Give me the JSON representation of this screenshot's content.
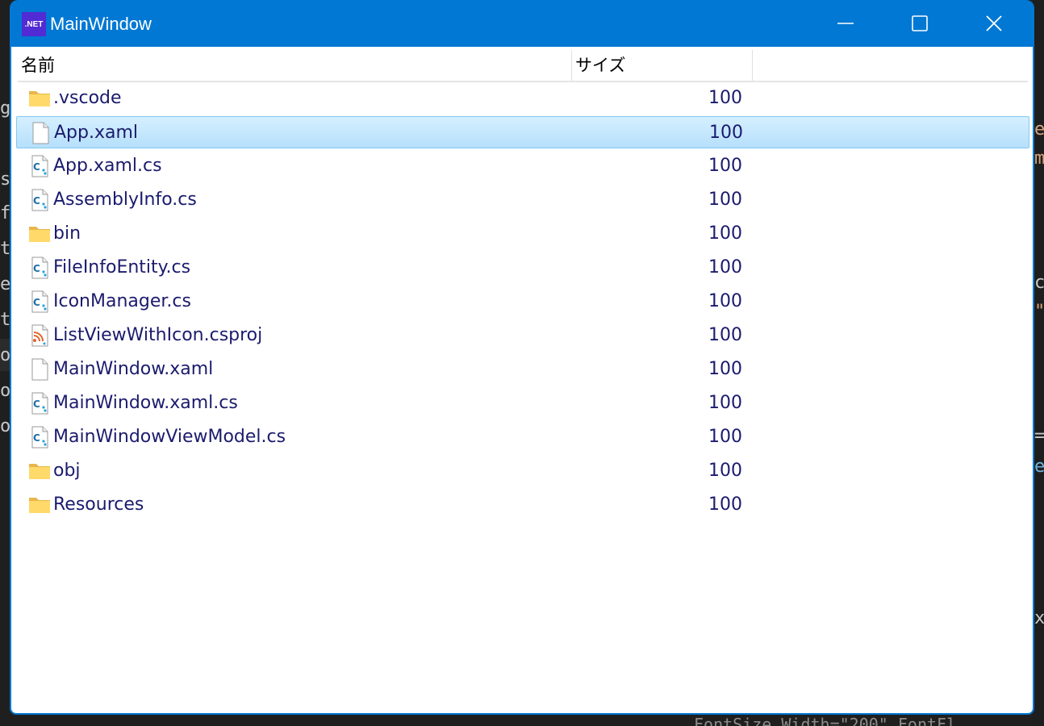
{
  "window": {
    "title": "MainWindow",
    "app_icon_label": ".NET",
    "accent_color": "#0078d4"
  },
  "columns": {
    "name": "名前",
    "size": "サイズ"
  },
  "files": [
    {
      "name": ".vscode",
      "size": "100",
      "icon": "folder-icon",
      "selected": false
    },
    {
      "name": "App.xaml",
      "size": "100",
      "icon": "file-icon",
      "selected": true
    },
    {
      "name": "App.xaml.cs",
      "size": "100",
      "icon": "csharp-file-icon",
      "selected": false
    },
    {
      "name": "AssemblyInfo.cs",
      "size": "100",
      "icon": "csharp-file-icon",
      "selected": false
    },
    {
      "name": "bin",
      "size": "100",
      "icon": "folder-icon",
      "selected": false
    },
    {
      "name": "FileInfoEntity.cs",
      "size": "100",
      "icon": "csharp-file-icon",
      "selected": false
    },
    {
      "name": "IconManager.cs",
      "size": "100",
      "icon": "csharp-file-icon",
      "selected": false
    },
    {
      "name": "ListViewWithIcon.csproj",
      "size": "100",
      "icon": "csproj-file-icon",
      "selected": false
    },
    {
      "name": "MainWindow.xaml",
      "size": "100",
      "icon": "file-icon",
      "selected": false
    },
    {
      "name": "MainWindow.xaml.cs",
      "size": "100",
      "icon": "csharp-file-icon",
      "selected": false
    },
    {
      "name": "MainWindowViewModel.cs",
      "size": "100",
      "icon": "csharp-file-icon",
      "selected": false
    },
    {
      "name": "obj",
      "size": "100",
      "icon": "folder-icon",
      "selected": false
    },
    {
      "name": "Resources",
      "size": "100",
      "icon": "folder-icon",
      "selected": false
    }
  ],
  "background": {
    "left_fragments": [
      "g",
      "s",
      "fo",
      "ty",
      "e",
      "th",
      "ov",
      "ov",
      "ov"
    ],
    "right_fragments": [
      "e",
      "m",
      "c",
      "\"",
      "=",
      "e",
      "x"
    ],
    "bottom_text": "FontSize Width=\"200\" FontFl"
  }
}
